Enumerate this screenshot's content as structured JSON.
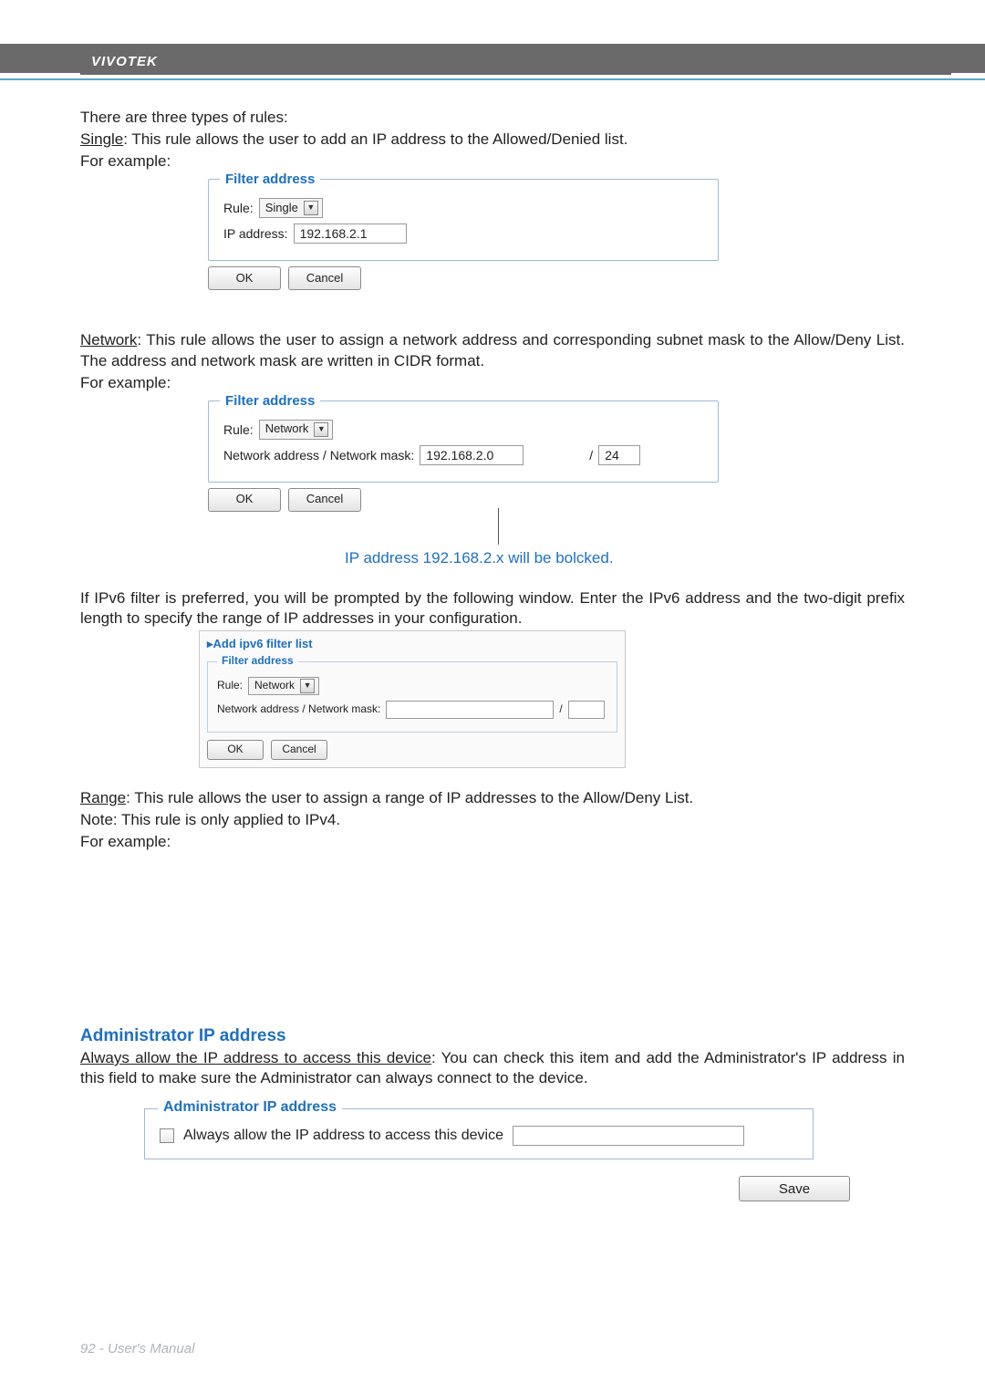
{
  "brand": "VIVOTEK",
  "intro": {
    "line1": "There are three types of rules:",
    "single_label": "Single",
    "single_desc": ": This rule allows the user to add an IP address to the Allowed/Denied list.",
    "for_example": "For example:"
  },
  "fs1": {
    "legend": "Filter address",
    "rule_label": "Rule:",
    "rule_value": "Single",
    "ip_label": "IP address:",
    "ip_value": "192.168.2.1",
    "ok": "OK",
    "cancel": "Cancel"
  },
  "network": {
    "label": "Network",
    "desc": ": This rule allows the user to assign a network address and corresponding subnet mask to the Allow/Deny List. The address and network mask are written in CIDR format.",
    "for_example": "For example:"
  },
  "fs2": {
    "legend": "Filter address",
    "rule_label": "Rule:",
    "rule_value": "Network",
    "netaddr_label": "Network address / Network mask:",
    "netaddr_value": "192.168.2.0",
    "slash": "/",
    "mask_value": "24",
    "ok": "OK",
    "cancel": "Cancel"
  },
  "callout": "IP address 192.168.2.x will be bolcked.",
  "ipv6_intro": "If IPv6 filter is preferred, you will be prompted by the following window. Enter the IPv6 address and the two-digit prefix length to specify the range of IP addresses in your configuration.",
  "ipv6": {
    "title": "▸Add ipv6 filter list",
    "legend": "Filter address",
    "rule_label": "Rule:",
    "rule_value": "Network",
    "netaddr_label": "Network address / Network mask:",
    "netaddr_value": "",
    "slash": "/",
    "mask_value": "",
    "ok": "OK",
    "cancel": "Cancel"
  },
  "range": {
    "label": "Range",
    "desc": ": This rule allows the user to assign a range of IP addresses to the Allow/Deny List.",
    "note": "Note: This rule is only applied to IPv4.",
    "for_example": "For example:"
  },
  "admin": {
    "heading": "Administrator IP address",
    "always_label_u": "Always allow the IP address to access this device",
    "always_desc": ": You can check this item and add the Administrator's IP address in this field to make sure the Administrator can always connect to the device.",
    "legend": "Administrator IP address",
    "chk_label": "Always allow the IP address to access this device",
    "ip_value": "",
    "save": "Save"
  },
  "footer": "92 - User's Manual"
}
